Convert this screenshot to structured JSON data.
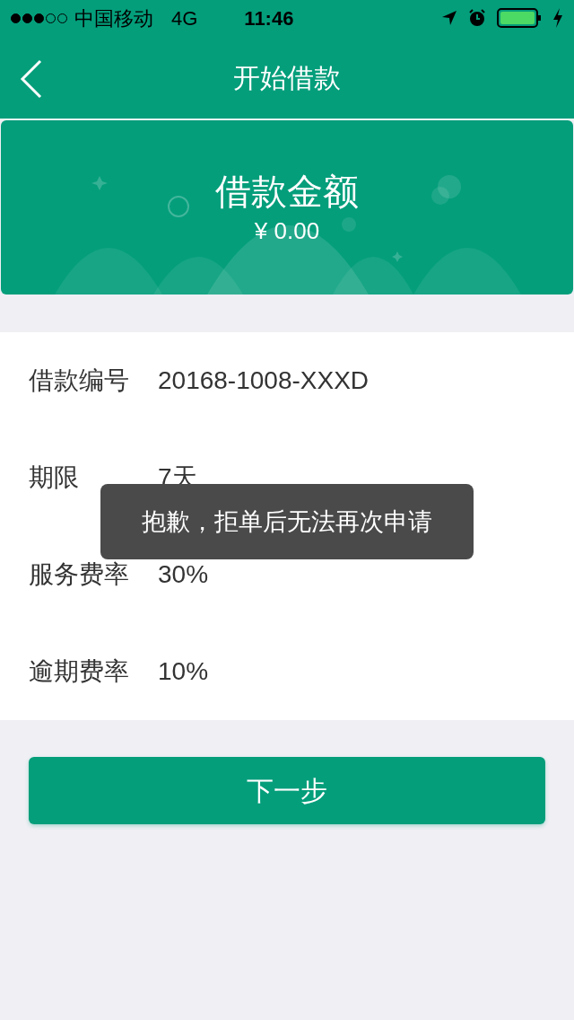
{
  "status_bar": {
    "carrier": "中国移动",
    "network": "4G",
    "time": "11:46"
  },
  "nav": {
    "title": "开始借款"
  },
  "banner": {
    "title": "借款金额",
    "amount": "¥ 0.00"
  },
  "details": [
    {
      "label": "借款编号",
      "value": "20168-1008-XXXD"
    },
    {
      "label": "期限",
      "value": "7天"
    },
    {
      "label": "服务费率",
      "value": "30%"
    },
    {
      "label": "逾期费率",
      "value": "10%"
    }
  ],
  "next_button": "下一步",
  "toast": "抱歉，拒单后无法再次申请"
}
